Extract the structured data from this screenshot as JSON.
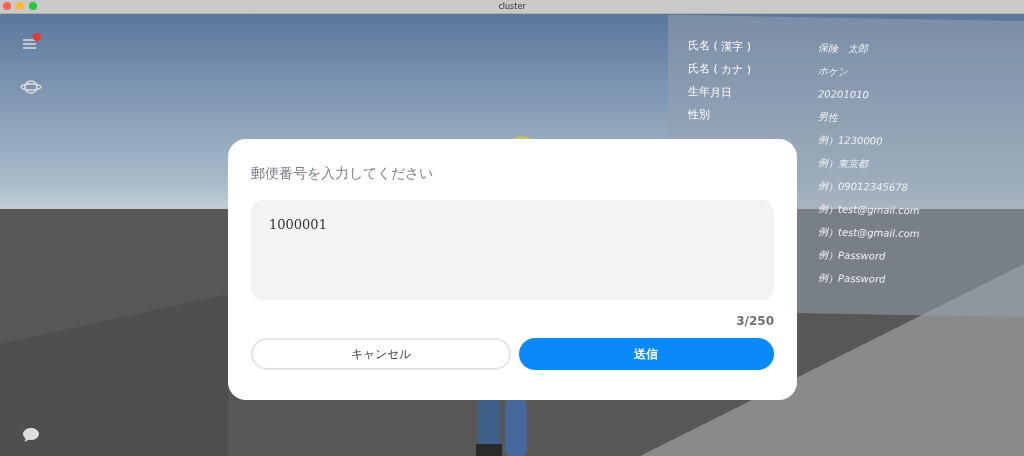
{
  "window": {
    "title": "cluster"
  },
  "menu": {
    "has_notification": true
  },
  "board": {
    "rows": [
      {
        "label": "氏名 ( 漢字 )",
        "value": "保険　太郎"
      },
      {
        "label": "氏名 ( カナ )",
        "value": "ホケン"
      },
      {
        "label": "生年月日",
        "value": "20201010"
      },
      {
        "label": "性別",
        "value": "男性"
      },
      {
        "value": "例）1230000"
      },
      {
        "value": "例）東京都"
      },
      {
        "value": "例）09012345678"
      },
      {
        "value": "例）test@gmail.com"
      },
      {
        "value": "例）test@gmail.com"
      },
      {
        "value": "例）Password"
      },
      {
        "value": "例）Password"
      }
    ]
  },
  "dialog": {
    "title": "郵便番号を入力してください",
    "value": "1000001",
    "counter": "3/250",
    "buttons": [
      {
        "label": "キャンセル",
        "kind": "secondary"
      },
      {
        "label": "送信",
        "kind": "primary"
      }
    ]
  }
}
